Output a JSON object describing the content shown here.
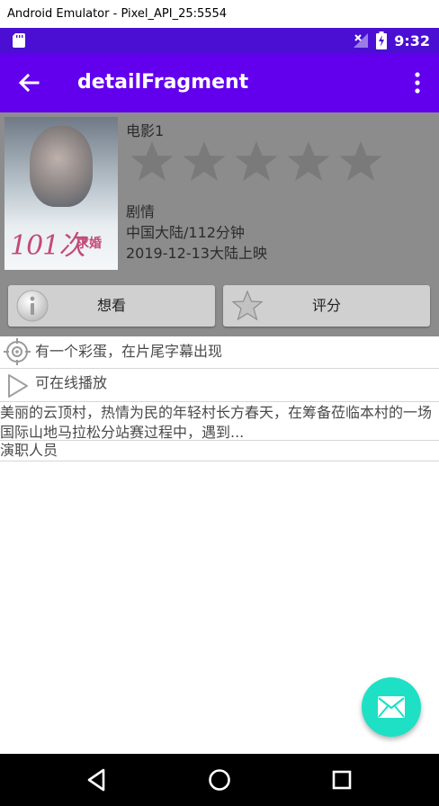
{
  "window": {
    "title": "Android Emulator - Pixel_API_25:5554"
  },
  "status_bar": {
    "time": "9:32"
  },
  "app_bar": {
    "title": "detailFragment"
  },
  "movie": {
    "title": "电影1",
    "rating_stars": 5,
    "genre": "剧情",
    "region_duration": "中国大陆/112分钟",
    "release": "2019-12-13大陆上映",
    "poster_text": "101次",
    "poster_sub": "求婚"
  },
  "buttons": {
    "want_label": "想看",
    "rate_label": "评分"
  },
  "rows": {
    "easter_egg": "有一个彩蛋，在片尾字幕出现",
    "online": "可在线播放",
    "description": "美丽的云顶村，热情为民的年轻村长方春天，在筹备莅临本村的一场国际山地马拉松分站赛过程中，遇到...",
    "cast": "演职人员"
  },
  "colors": {
    "status_bar": "#4a0fd3",
    "app_bar": "#6200ee",
    "fab": "#1ee0c5",
    "overlay": "#8c8c8c"
  }
}
